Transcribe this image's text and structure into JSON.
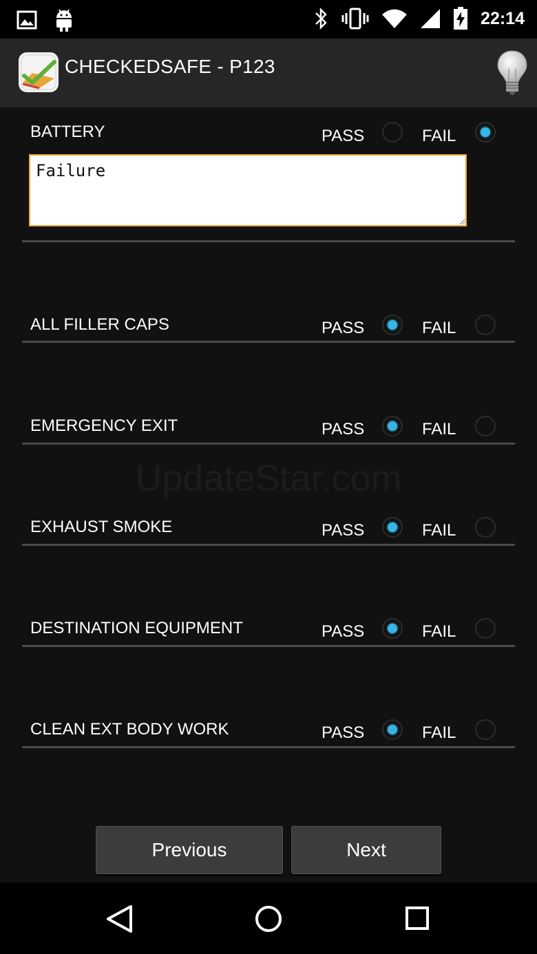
{
  "status_bar": {
    "time": "22:14",
    "left_icons": [
      "image-icon",
      "android-icon"
    ],
    "right_icons": [
      "bluetooth-icon",
      "vibrate-icon",
      "wifi-icon",
      "signal-icon",
      "battery-charging-icon"
    ]
  },
  "action_bar": {
    "title": "CHECKEDSAFE - P123",
    "icons": [
      "app-logo-icon",
      "lightbulb-icon"
    ]
  },
  "options": {
    "pass": "PASS",
    "fail": "FAIL"
  },
  "checks": [
    {
      "label": "BATTERY",
      "result": "FAIL",
      "comment": "Failure"
    },
    {
      "label": "ALL FILLER CAPS",
      "result": "PASS"
    },
    {
      "label": "EMERGENCY EXIT",
      "result": "PASS"
    },
    {
      "label": "EXHAUST SMOKE",
      "result": "PASS"
    },
    {
      "label": "DESTINATION EQUIPMENT",
      "result": "PASS"
    },
    {
      "label": "CLEAN EXT BODY WORK",
      "result": "PASS"
    }
  ],
  "watermark": "UpdateStar.com",
  "buttons": {
    "previous": "Previous",
    "next": "Next"
  },
  "colors": {
    "accent": "#35b5e5",
    "focus_border": "#f2a32b",
    "background": "#111111",
    "action_bar": "#262626"
  },
  "nav_bar": {
    "icons": [
      "back-icon",
      "home-icon",
      "recents-icon"
    ]
  }
}
